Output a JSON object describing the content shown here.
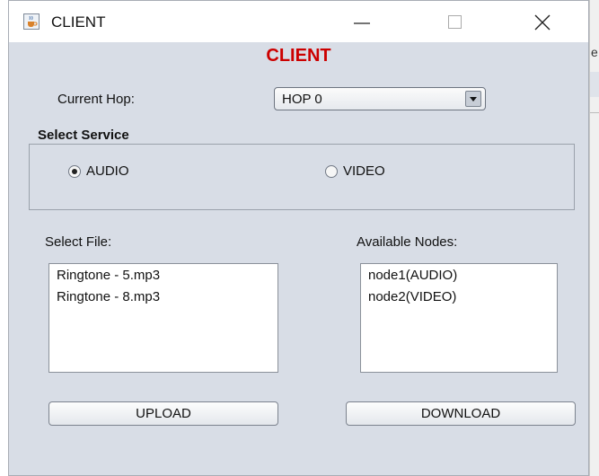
{
  "window": {
    "title": "CLIENT",
    "icon": "java-cup-icon"
  },
  "titlebar_buttons": [
    "minimize-icon",
    "maximize-icon",
    "close-icon"
  ],
  "header": {
    "title": "CLIENT",
    "color": "#cc0000"
  },
  "hop": {
    "label": "Current Hop:",
    "selected": "HOP 0"
  },
  "service": {
    "label": "Select Service",
    "options": [
      {
        "label": "AUDIO",
        "checked": true
      },
      {
        "label": "VIDEO",
        "checked": false
      }
    ]
  },
  "files": {
    "label": "Select File:",
    "items": [
      "Ringtone - 5.mp3",
      "Ringtone - 8.mp3"
    ]
  },
  "nodes": {
    "label": "Available Nodes:",
    "items": [
      "node1(AUDIO)",
      "node2(VIDEO)"
    ]
  },
  "buttons": {
    "upload": "UPLOAD",
    "download": "DOWNLOAD"
  },
  "background_window": {
    "partial_char": "e"
  }
}
